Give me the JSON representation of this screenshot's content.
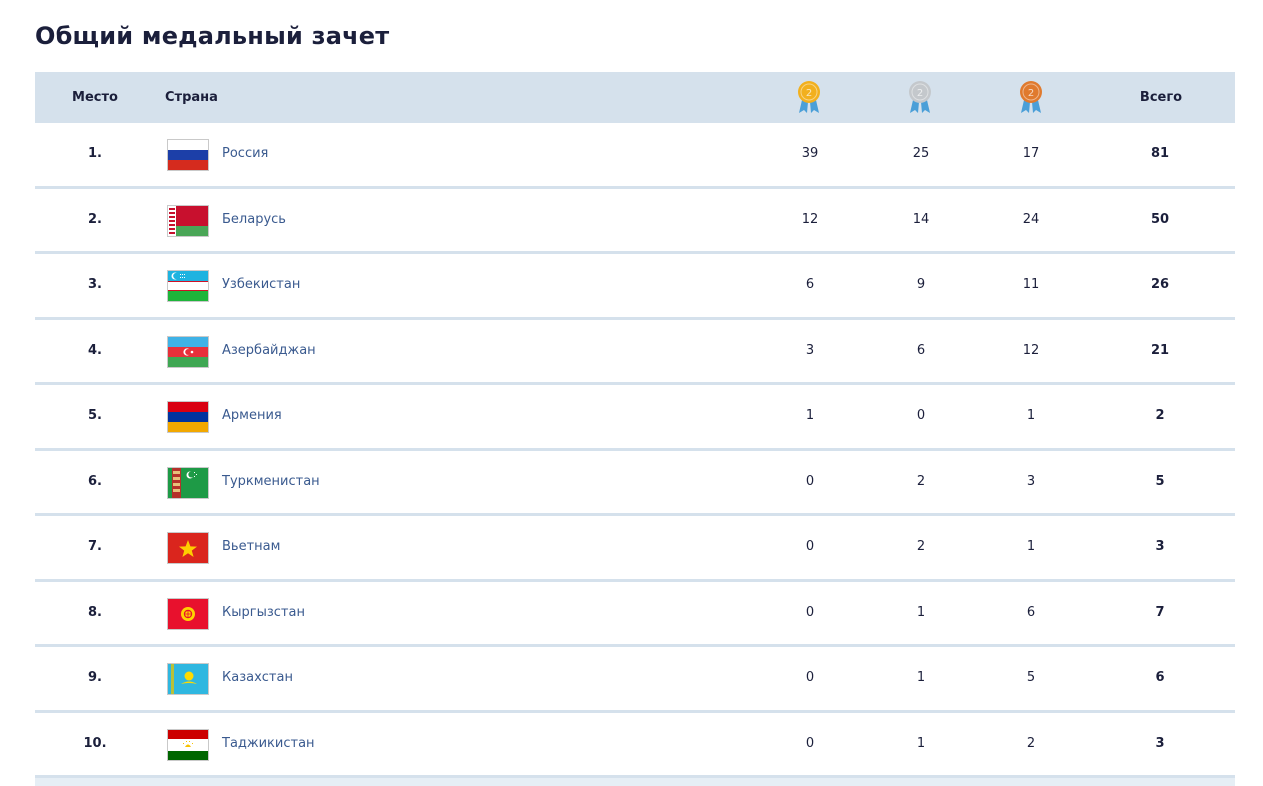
{
  "title": "Общий медальный зачет",
  "header": {
    "place": "Место",
    "country": "Страна",
    "total": "Всего"
  },
  "medal_colors": {
    "gold": "#f2b01e",
    "silver": "#c4c8cc",
    "bronze": "#e07a2e",
    "ribbon": "#4a9fd8"
  },
  "rows": [
    {
      "place": "1.",
      "country": "Россия",
      "flag": "russia",
      "gold": "39",
      "silver": "25",
      "bronze": "17",
      "total": "81"
    },
    {
      "place": "2.",
      "country": "Беларусь",
      "flag": "belarus",
      "gold": "12",
      "silver": "14",
      "bronze": "24",
      "total": "50"
    },
    {
      "place": "3.",
      "country": "Узбекистан",
      "flag": "uzbekistan",
      "gold": "6",
      "silver": "9",
      "bronze": "11",
      "total": "26"
    },
    {
      "place": "4.",
      "country": "Азербайджан",
      "flag": "azerbaijan",
      "gold": "3",
      "silver": "6",
      "bronze": "12",
      "total": "21"
    },
    {
      "place": "5.",
      "country": "Армения",
      "flag": "armenia",
      "gold": "1",
      "silver": "0",
      "bronze": "1",
      "total": "2"
    },
    {
      "place": "6.",
      "country": "Туркменистан",
      "flag": "turkmenistan",
      "gold": "0",
      "silver": "2",
      "bronze": "3",
      "total": "5"
    },
    {
      "place": "7.",
      "country": "Вьетнам",
      "flag": "vietnam",
      "gold": "0",
      "silver": "2",
      "bronze": "1",
      "total": "3"
    },
    {
      "place": "8.",
      "country": "Кыргызстан",
      "flag": "kyrgyzstan",
      "gold": "0",
      "silver": "1",
      "bronze": "6",
      "total": "7"
    },
    {
      "place": "9.",
      "country": "Казахстан",
      "flag": "kazakhstan",
      "gold": "0",
      "silver": "1",
      "bronze": "5",
      "total": "6"
    },
    {
      "place": "10.",
      "country": "Таджикистан",
      "flag": "tajikistan",
      "gold": "0",
      "silver": "1",
      "bronze": "2",
      "total": "3"
    }
  ]
}
